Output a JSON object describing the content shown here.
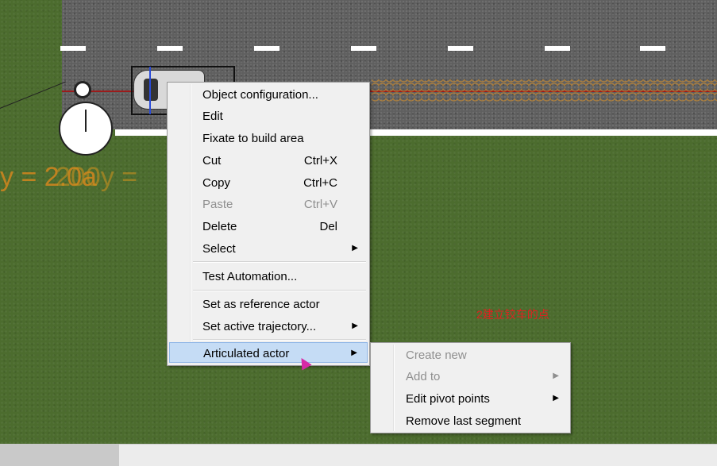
{
  "canvas": {
    "overlay_label": "y = 2.0a",
    "overlay_label_2": "200y =",
    "note": "2建立铰车的点",
    "colors": {
      "grass": "#4c6c2e",
      "road": "#5f5f5f",
      "trajectory": "#9b1b1b",
      "overlay": "#d4861e",
      "note": "#e02020",
      "highlight": "#c5dcf5"
    }
  },
  "context_menu": {
    "items": [
      {
        "label": "Object configuration...",
        "shortcut": "",
        "submenu": false,
        "disabled": false
      },
      {
        "label": "Edit",
        "shortcut": "",
        "submenu": false,
        "disabled": false
      },
      {
        "label": "Fixate to build area",
        "shortcut": "",
        "submenu": false,
        "disabled": false
      },
      {
        "label": "Cut",
        "shortcut": "Ctrl+X",
        "submenu": false,
        "disabled": false
      },
      {
        "label": "Copy",
        "shortcut": "Ctrl+C",
        "submenu": false,
        "disabled": false
      },
      {
        "label": "Paste",
        "shortcut": "Ctrl+V",
        "submenu": false,
        "disabled": true
      },
      {
        "label": "Delete",
        "shortcut": "Del",
        "submenu": false,
        "disabled": false
      },
      {
        "label": "Select",
        "shortcut": "",
        "submenu": true,
        "disabled": false
      },
      {
        "label": "Test Automation...",
        "shortcut": "",
        "submenu": false,
        "disabled": false
      },
      {
        "label": "Set as reference actor",
        "shortcut": "",
        "submenu": false,
        "disabled": false
      },
      {
        "label": "Set active trajectory...",
        "shortcut": "",
        "submenu": true,
        "disabled": false
      },
      {
        "label": "Articulated actor",
        "shortcut": "",
        "submenu": true,
        "disabled": false,
        "highlighted": true
      }
    ]
  },
  "submenu": {
    "items": [
      {
        "label": "Create new",
        "submenu": false,
        "disabled": true
      },
      {
        "label": "Add to",
        "submenu": true,
        "disabled": true
      },
      {
        "label": "Edit pivot points",
        "submenu": true,
        "disabled": false
      },
      {
        "label": "Remove last segment",
        "submenu": false,
        "disabled": false
      }
    ]
  },
  "icons": {
    "submenu_arrow": "triangle-right-icon",
    "stopwatch": "stopwatch-icon",
    "cursor": "mouse-cursor-icon"
  }
}
